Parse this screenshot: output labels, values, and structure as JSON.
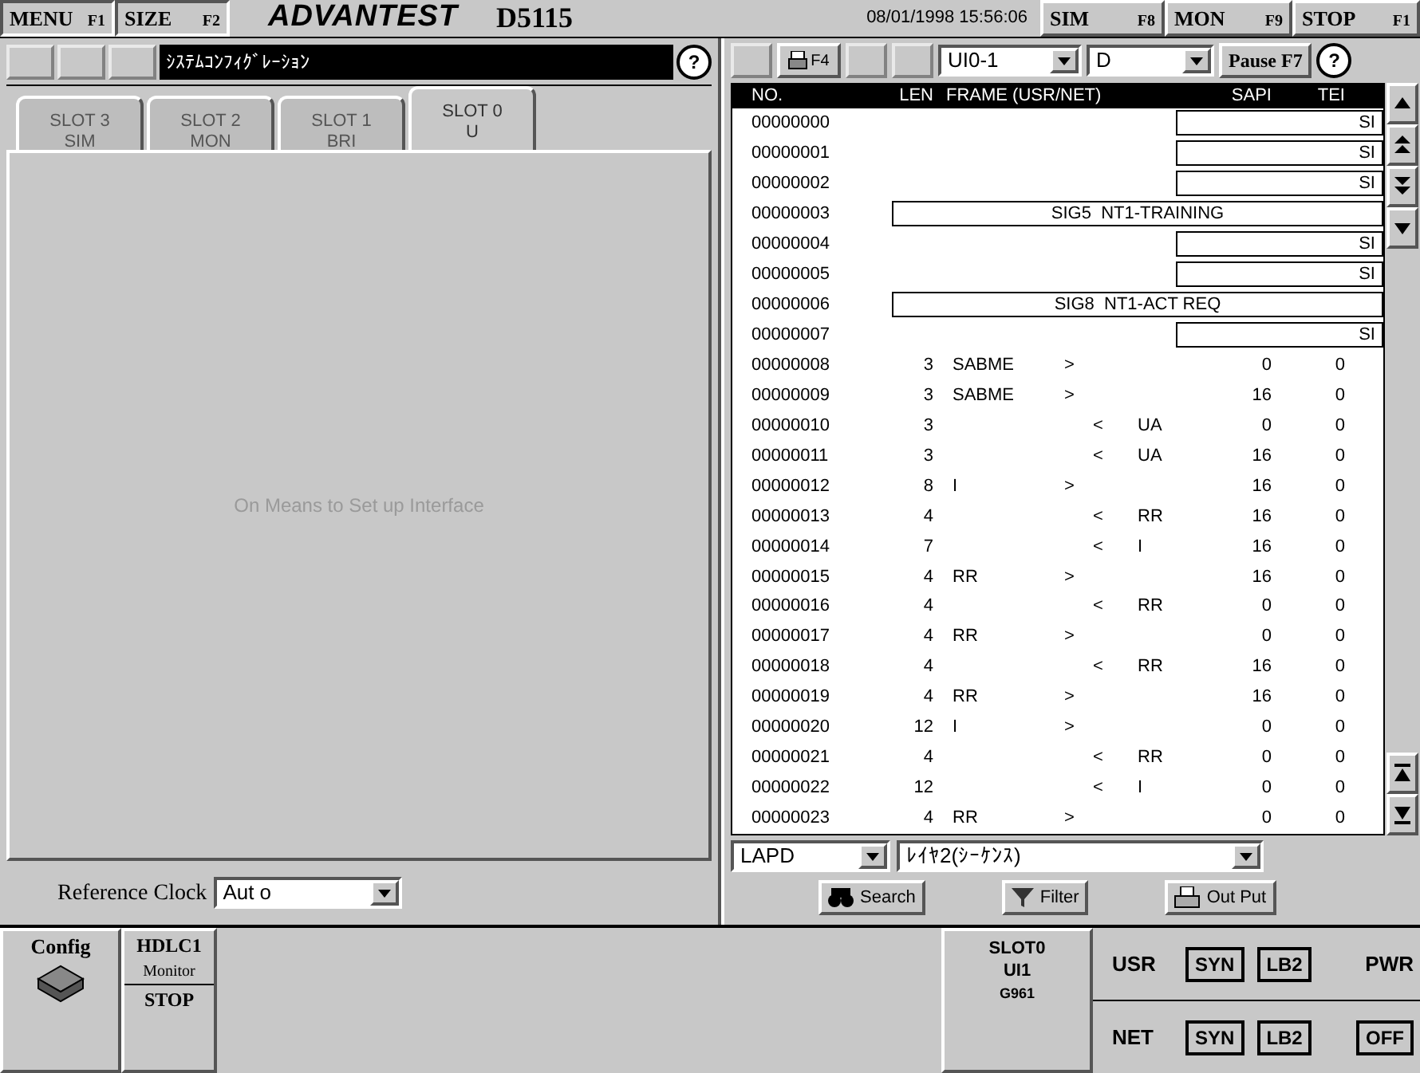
{
  "top_bar": {
    "keys": [
      {
        "label": "MENU",
        "key": "F1"
      },
      {
        "label": "SIZE",
        "key": "F2"
      }
    ],
    "logo": "ADVANTEST",
    "model": "D5115",
    "datetime": "08/01/1998 15:56:06",
    "modes": [
      {
        "label": "SIM",
        "key": "F8"
      },
      {
        "label": "MON",
        "key": "F9"
      },
      {
        "label": "STOP",
        "key": "F1"
      }
    ]
  },
  "config_panel": {
    "title": "ｼｽﾃﾑｺﾝﾌｨｸﾞﾚｰｼｮﾝ",
    "help": "?",
    "tabs": [
      {
        "slot": "SLOT 3",
        "type": "SIM",
        "selected": false
      },
      {
        "slot": "SLOT 2",
        "type": "MON",
        "selected": false
      },
      {
        "slot": "SLOT 1",
        "type": "BRI",
        "selected": false
      },
      {
        "slot": "SLOT 0",
        "type": "U",
        "selected": true
      }
    ],
    "message": "On Means to Set up Interface",
    "reference_clock": {
      "label": "Reference Clock",
      "value": "Aut o"
    }
  },
  "monitor_panel": {
    "print_key": "F4",
    "port": "UI0-1",
    "channel": "D",
    "pause": "Pause F7",
    "help": "?",
    "columns": [
      "NO.",
      "LEN",
      "FRAME (USR/NET)",
      "SAPI",
      "TEI"
    ],
    "rows": [
      {
        "no": "00000000",
        "kind": "status",
        "text": "SI"
      },
      {
        "no": "00000001",
        "kind": "status",
        "text": "SI"
      },
      {
        "no": "00000002",
        "kind": "status",
        "text": "SI"
      },
      {
        "no": "00000003",
        "kind": "event",
        "text": "SIG5  NT1-TRAINING"
      },
      {
        "no": "00000004",
        "kind": "status",
        "text": "SI"
      },
      {
        "no": "00000005",
        "kind": "status",
        "text": "SI"
      },
      {
        "no": "00000006",
        "kind": "event",
        "text": "SIG8  NT1-ACT REQ"
      },
      {
        "no": "00000007",
        "kind": "status",
        "text": "SI"
      },
      {
        "no": "00000008",
        "kind": "frame",
        "len": "3",
        "usr": "SABME",
        "dir": ">",
        "sapi": "0",
        "tei": "0"
      },
      {
        "no": "00000009",
        "kind": "frame",
        "len": "3",
        "usr": "SABME",
        "dir": ">",
        "sapi": "16",
        "tei": "0"
      },
      {
        "no": "00000010",
        "kind": "frame",
        "len": "3",
        "dir": "<",
        "net": "UA",
        "sapi": "0",
        "tei": "0"
      },
      {
        "no": "00000011",
        "kind": "frame",
        "len": "3",
        "dir": "<",
        "net": "UA",
        "sapi": "16",
        "tei": "0"
      },
      {
        "no": "00000012",
        "kind": "frame",
        "len": "8",
        "usr": "I",
        "dir": ">",
        "sapi": "16",
        "tei": "0"
      },
      {
        "no": "00000013",
        "kind": "frame",
        "len": "4",
        "dir": "<",
        "net": "RR",
        "sapi": "16",
        "tei": "0"
      },
      {
        "no": "00000014",
        "kind": "frame",
        "len": "7",
        "dir": "<",
        "net": "I",
        "sapi": "16",
        "tei": "0"
      },
      {
        "no": "00000015",
        "kind": "frame",
        "len": "4",
        "usr": "RR",
        "dir": ">",
        "sapi": "16",
        "tei": "0"
      },
      {
        "no": "00000016",
        "kind": "frame",
        "len": "4",
        "dir": "<",
        "net": "RR",
        "sapi": "0",
        "tei": "0"
      },
      {
        "no": "00000017",
        "kind": "frame",
        "len": "4",
        "usr": "RR",
        "dir": ">",
        "sapi": "0",
        "tei": "0"
      },
      {
        "no": "00000018",
        "kind": "frame",
        "len": "4",
        "dir": "<",
        "net": "RR",
        "sapi": "16",
        "tei": "0"
      },
      {
        "no": "00000019",
        "kind": "frame",
        "len": "4",
        "usr": "RR",
        "dir": ">",
        "sapi": "16",
        "tei": "0"
      },
      {
        "no": "00000020",
        "kind": "frame",
        "len": "12",
        "usr": "I",
        "dir": ">",
        "sapi": "0",
        "tei": "0"
      },
      {
        "no": "00000021",
        "kind": "frame",
        "len": "4",
        "dir": "<",
        "net": "RR",
        "sapi": "0",
        "tei": "0"
      },
      {
        "no": "00000022",
        "kind": "frame",
        "len": "12",
        "dir": "<",
        "net": "I",
        "sapi": "0",
        "tei": "0"
      },
      {
        "no": "00000023",
        "kind": "frame",
        "len": "4",
        "usr": "RR",
        "dir": ">",
        "sapi": "0",
        "tei": "0"
      }
    ],
    "protocol": "LAPD",
    "layer": "ﾚｲﾔ2(ｼｰｹﾝｽ)",
    "actions": [
      "Search",
      "Filter",
      "Out Put"
    ]
  },
  "status_bar": {
    "config": "Config",
    "monitor": {
      "name": "HDLC1",
      "sub": "Monitor",
      "state": "STOP"
    },
    "slot": {
      "slot": "SLOT0",
      "iface": "UI1",
      "code": "G961"
    },
    "lines": [
      {
        "label": "USR",
        "flags": [
          "SYN",
          "LB2"
        ],
        "kind": "label",
        "extra": "PWR"
      },
      {
        "label": "NET",
        "flags": [
          "SYN",
          "LB2"
        ],
        "kind": "box",
        "extra": "OFF"
      }
    ]
  }
}
